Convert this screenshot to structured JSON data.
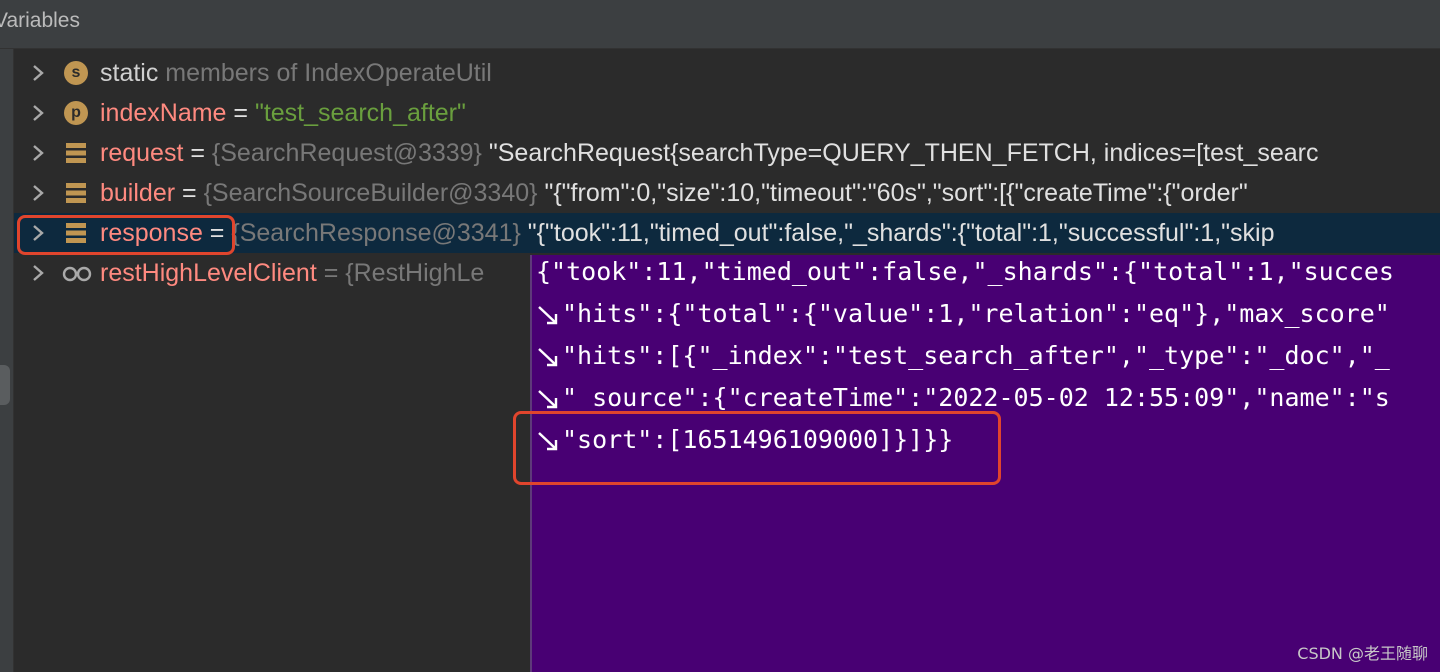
{
  "header": {
    "title": "Variables"
  },
  "rows": [
    {
      "icon": "s",
      "name": "static",
      "eq": "",
      "type": " members of IndexOperateUtil",
      "value": ""
    },
    {
      "icon": "p",
      "name": "indexName",
      "eq": " = ",
      "type": "",
      "value": "\"test_search_after\""
    },
    {
      "icon": "field",
      "name": "request",
      "eq": " = ",
      "type": "{SearchRequest@3339}",
      "value": " \"SearchRequest{searchType=QUERY_THEN_FETCH, indices=[test_searc"
    },
    {
      "icon": "field",
      "name": "builder",
      "eq": " = ",
      "type": "{SearchSourceBuilder@3340}",
      "value": " \"{\"from\":0,\"size\":10,\"timeout\":\"60s\",\"sort\":[{\"createTime\":{\"order\""
    },
    {
      "icon": "field",
      "name": "response",
      "eq": " = ",
      "type": "{SearchResponse@3341}",
      "value": " \"{\"took\":11,\"timed_out\":false,\"_shards\":{\"total\":1,\"successful\":1,\"skip"
    },
    {
      "icon": "watch",
      "name": "restHighLevelClient",
      "eq": " = ",
      "type": "{RestHighLe",
      "value": ""
    }
  ],
  "popup": {
    "lines": [
      "{\"took\":11,\"timed_out\":false,\"_shards\":{\"total\":1,\"succes",
      "\"hits\":{\"total\":{\"value\":1,\"relation\":\"eq\"},\"max_score\"",
      "\"hits\":[{\"_index\":\"test_search_after\",\"_type\":\"_doc\",\"_",
      "\"_source\":{\"createTime\":\"2022-05-02 12:55:09\",\"name\":\"s",
      "\"sort\":[1651496109000]}]}}"
    ]
  },
  "watermark": "CSDN @老王随聊",
  "colors": {
    "highlight": "#e0452d",
    "popup_bg": "#480073",
    "selected_row": "#0d293e"
  }
}
